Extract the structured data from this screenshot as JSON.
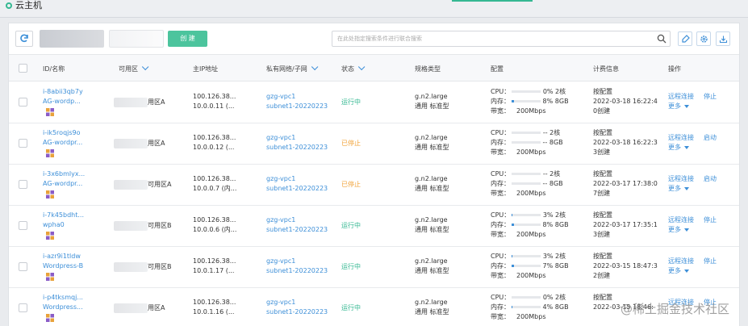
{
  "title": "云主机",
  "toolbar": {
    "create_label": "创 建",
    "search_placeholder": "在此处指定搜索条件进行联合搜索"
  },
  "columns": {
    "id": "ID/名称",
    "az": "可用区",
    "ip": "主IP地址",
    "vpc": "私有网络/子网",
    "status": "状态",
    "spec": "规格类型",
    "config": "配置",
    "billing": "计费信息",
    "ops": "操作"
  },
  "labels": {
    "cpu": "CPU：",
    "mem": "内存：",
    "bw": "带宽：",
    "billing_type": "按配置"
  },
  "rows": [
    {
      "id": "i-8abii3qb7y",
      "name": "AG-wordp...",
      "az": "用区A",
      "ip1": "100.126.38...",
      "ip2": "10.0.0.11 (...",
      "vpc": "gzg-vpc1",
      "subnet": "subnet1-20220223",
      "status": "运行中",
      "status_kind": "run",
      "spec1": "g.n2.large",
      "spec2": "通用 标准型",
      "cpu": "0% 2核",
      "cpu_pct": 0,
      "mem": "8% 8GB",
      "mem_pct": 8,
      "bw": "200Mbps",
      "date": "2022-03-18 16:22:4",
      "created": "0创建",
      "op1": "远程连接",
      "op2": "停止",
      "more": "更多"
    },
    {
      "id": "i-ik5roqjs9o",
      "name": "AG-wordpr...",
      "az": "用区A",
      "ip1": "100.126.38...",
      "ip2": "10.0.0.12 (...",
      "vpc": "gzg-vpc1",
      "subnet": "subnet1-20220223",
      "status": "已停止",
      "status_kind": "stop",
      "spec1": "g.n2.large",
      "spec2": "通用 标准型",
      "cpu": "-- 2核",
      "cpu_pct": 0,
      "mem": "-- 8GB",
      "mem_pct": 0,
      "bw": "200Mbps",
      "date": "2022-03-18 16:22:3",
      "created": "3创建",
      "op1": "远程连接",
      "op2": "启动",
      "more": "更多"
    },
    {
      "id": "i-3x6bmlyx...",
      "name": "AG-wordpr...",
      "az": "可用区A",
      "ip1": "100.126.38...",
      "ip2": "10.0.0.7 (内...",
      "vpc": "gzg-vpc1",
      "subnet": "subnet1-20220223",
      "status": "已停止",
      "status_kind": "stop",
      "spec1": "g.n2.large",
      "spec2": "通用 标准型",
      "cpu": "-- 2核",
      "cpu_pct": 0,
      "mem": "-- 8GB",
      "mem_pct": 0,
      "bw": "200Mbps",
      "date": "2022-03-17 17:38:0",
      "created": "7创建",
      "op1": "远程连接",
      "op2": "启动",
      "more": "更多"
    },
    {
      "id": "i-7k45bdht...",
      "name": "wpha0",
      "az": "可用区B",
      "ip1": "100.126.38...",
      "ip2": "10.0.0.6 (内...",
      "vpc": "gzg-vpc1",
      "subnet": "subnet1-20220223",
      "status": "运行中",
      "status_kind": "run",
      "spec1": "g.n2.large",
      "spec2": "通用 标准型",
      "cpu": "3% 2核",
      "cpu_pct": 3,
      "mem": "8% 8GB",
      "mem_pct": 8,
      "bw": "200Mbps",
      "date": "2022-03-17 17:35:1",
      "created": "3创建",
      "op1": "远程连接",
      "op2": "停止",
      "more": "更多"
    },
    {
      "id": "i-azr9i1tldw",
      "name": "Wordpress-B",
      "az": "可用区B",
      "ip1": "100.126.38...",
      "ip2": "10.0.1.17 (...",
      "vpc": "gzg-vpc1",
      "subnet": "subnet1-20220223",
      "status": "运行中",
      "status_kind": "run",
      "spec1": "g.n2.large",
      "spec2": "通用 标准型",
      "cpu": "3% 2核",
      "cpu_pct": 3,
      "mem": "7% 8GB",
      "mem_pct": 7,
      "bw": "200Mbps",
      "date": "2022-03-15 18:47:3",
      "created": "2创建",
      "op1": "远程连接",
      "op2": "停止",
      "more": "更多"
    },
    {
      "id": "i-p4tksmqj...",
      "name": "Wordpress...",
      "az": "用区A",
      "ip1": "100.126.38...",
      "ip2": "10.0.1.16 (...",
      "vpc": "gzg-vpc1",
      "subnet": "subnet1-20220223",
      "status": "运行中",
      "status_kind": "run",
      "spec1": "g.n2.large",
      "spec2": "通用 标准型",
      "cpu": "0% 2核",
      "cpu_pct": 0,
      "mem": "4% 8GB",
      "mem_pct": 4,
      "bw": "200Mbps",
      "date": "2022-03-15 18:46:",
      "created": "",
      "op1": "远程连接",
      "op2": "停止",
      "more": ""
    }
  ],
  "watermark": "@稀土掘金技术社区",
  "colors": {
    "accent": "#35b892",
    "link": "#3d8fd8",
    "stopped": "#f1a43c"
  }
}
